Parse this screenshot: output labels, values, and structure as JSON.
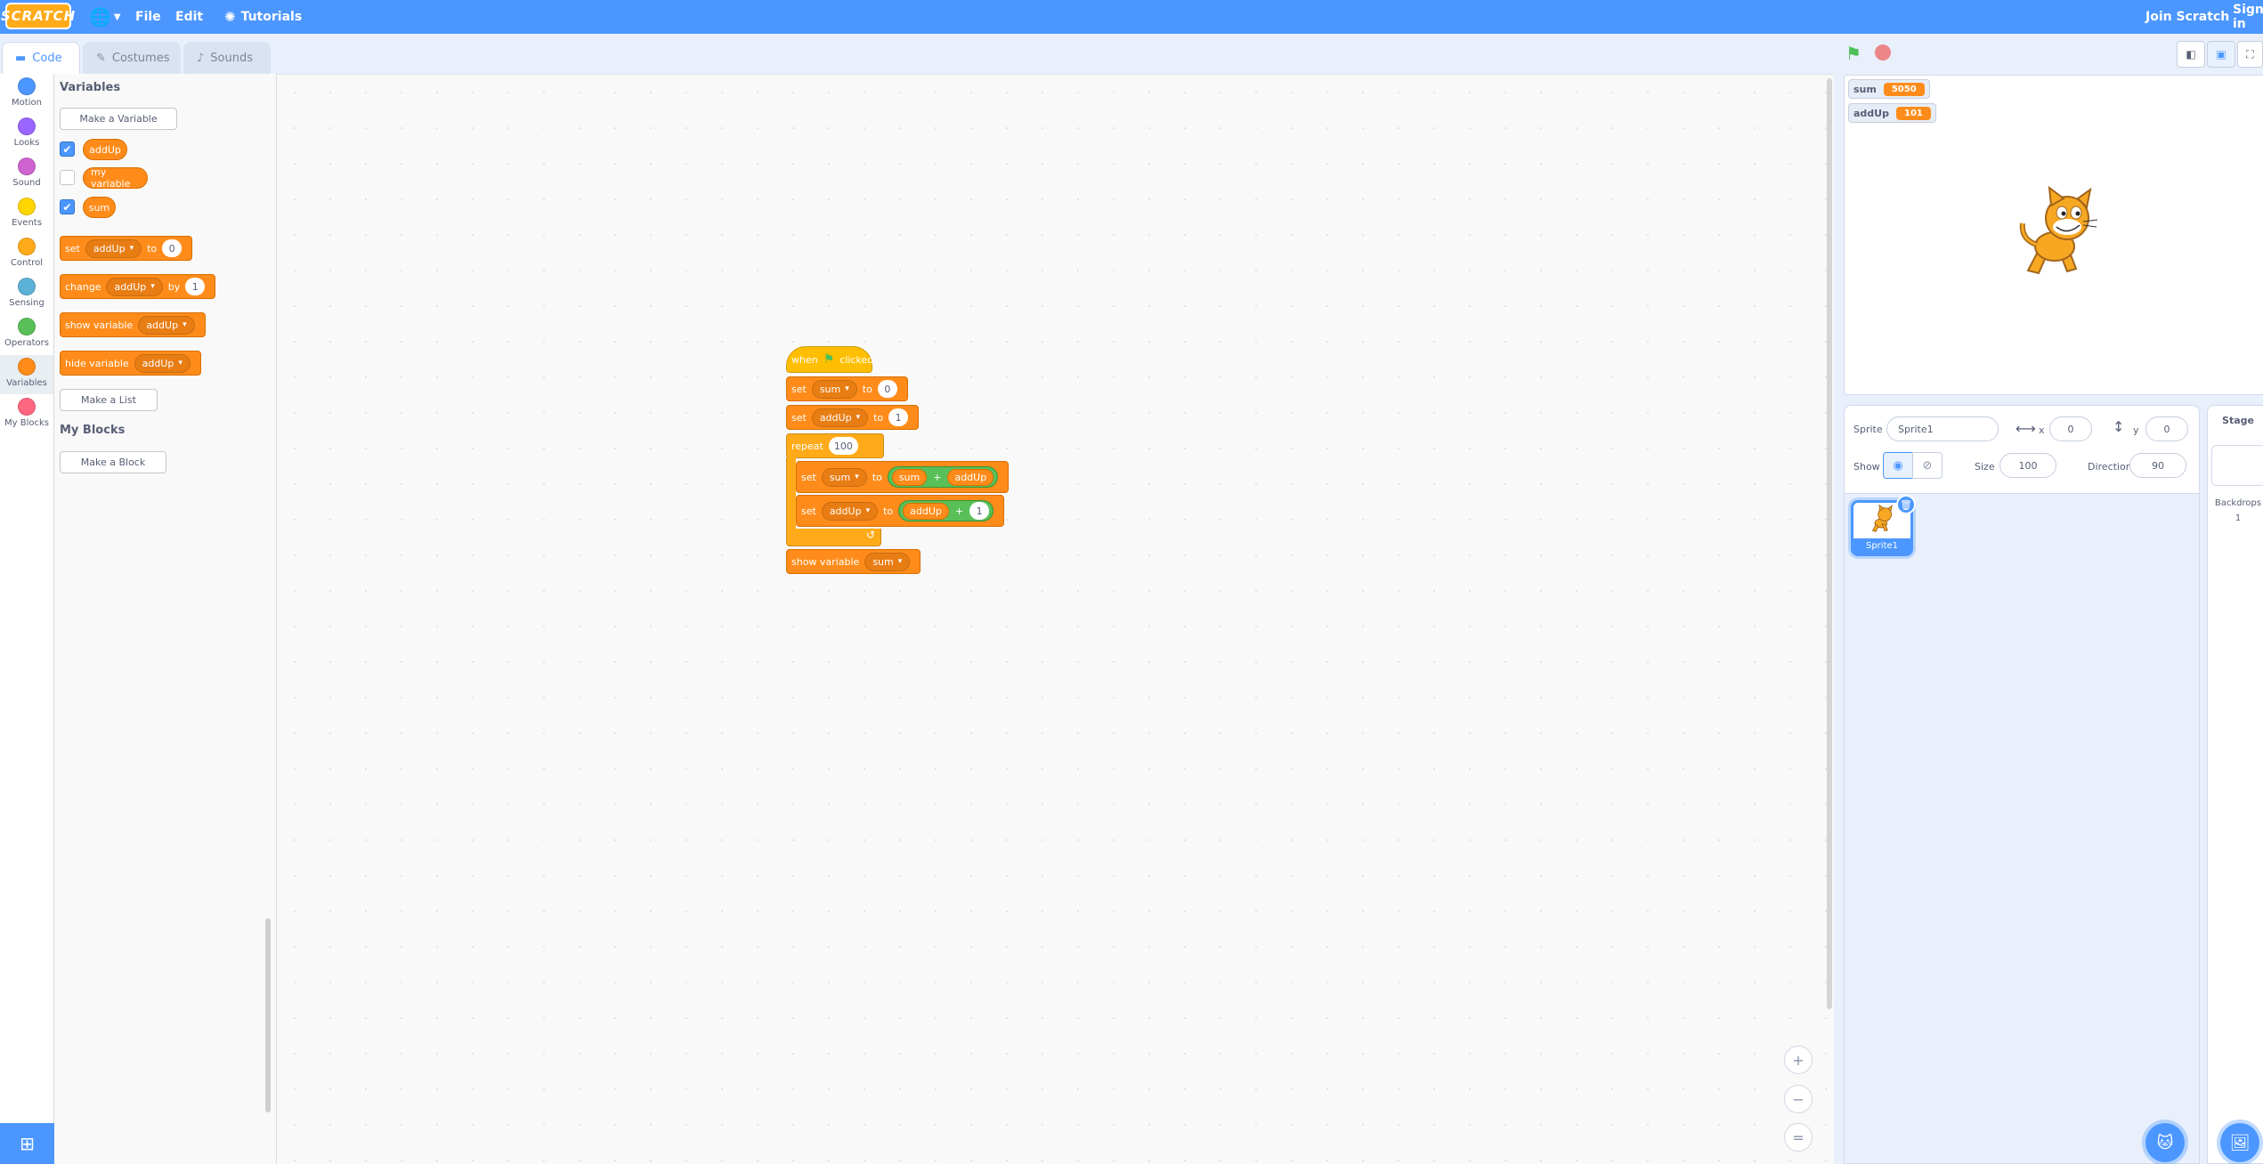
{
  "menubar": {
    "logo": "SCRATCH",
    "file": "File",
    "edit": "Edit",
    "tutorials": "Tutorials",
    "join": "Join Scratch",
    "signin": "Sign in"
  },
  "tabs": {
    "code": "Code",
    "costumes": "Costumes",
    "sounds": "Sounds"
  },
  "categories": [
    {
      "label": "Motion",
      "color": "#4c97ff"
    },
    {
      "label": "Looks",
      "color": "#9966ff"
    },
    {
      "label": "Sound",
      "color": "#cf63cf"
    },
    {
      "label": "Events",
      "color": "#ffd500"
    },
    {
      "label": "Control",
      "color": "#ffab19"
    },
    {
      "label": "Sensing",
      "color": "#5cb1d6"
    },
    {
      "label": "Operators",
      "color": "#59c059"
    },
    {
      "label": "Variables",
      "color": "#ff8c1a"
    },
    {
      "label": "My Blocks",
      "color": "#ff6680"
    }
  ],
  "palette": {
    "variables_heading": "Variables",
    "make_variable": "Make a Variable",
    "variables": [
      {
        "name": "addUp",
        "checked": true
      },
      {
        "name": "my variable",
        "checked": false
      },
      {
        "name": "sum",
        "checked": true
      }
    ],
    "set_block": {
      "kw": "set",
      "var": "addUp",
      "to": "to",
      "value": "0"
    },
    "change_block": {
      "kw": "change",
      "var": "addUp",
      "by": "by",
      "value": "1"
    },
    "show_block": {
      "kw": "show variable",
      "var": "addUp"
    },
    "hide_block": {
      "kw": "hide variable",
      "var": "addUp"
    },
    "make_list": "Make a List",
    "myblocks_heading": "My Blocks",
    "make_block": "Make a Block"
  },
  "script": {
    "hat": {
      "when": "when",
      "clicked": "clicked"
    },
    "set_sum": {
      "kw": "set",
      "var": "sum",
      "to": "to",
      "value": "0"
    },
    "set_addup": {
      "kw": "set",
      "var": "addUp",
      "to": "to",
      "value": "1"
    },
    "repeat": {
      "kw": "repeat",
      "value": "100"
    },
    "inner_set_sum": {
      "kw": "set",
      "var": "sum",
      "to": "to",
      "left": "sum",
      "op": "+",
      "right": "addUp"
    },
    "inner_set_addup": {
      "kw": "set",
      "var": "addUp",
      "to": "to",
      "left": "addUp",
      "op": "+",
      "right": "1"
    },
    "repeat_arrow": "↺",
    "show_sum": {
      "kw": "show variable",
      "var": "sum"
    }
  },
  "stage": {
    "monitors": [
      {
        "name": "sum",
        "value": "5050"
      },
      {
        "name": "addUp",
        "value": "101"
      }
    ]
  },
  "sprite_info": {
    "sprite_label": "Sprite",
    "sprite_name": "Sprite1",
    "x_label": "x",
    "x_value": "0",
    "y_label": "y",
    "y_value": "0",
    "show_label": "Show",
    "size_label": "Size",
    "size_value": "100",
    "direction_label": "Direction",
    "direction_value": "90",
    "thumb_name": "Sprite1"
  },
  "stage_selector": {
    "label": "Stage",
    "backdrops_label": "Backdrops",
    "backdrops_count": "1"
  },
  "zoom": {
    "in": "+",
    "out": "−",
    "reset": "="
  }
}
